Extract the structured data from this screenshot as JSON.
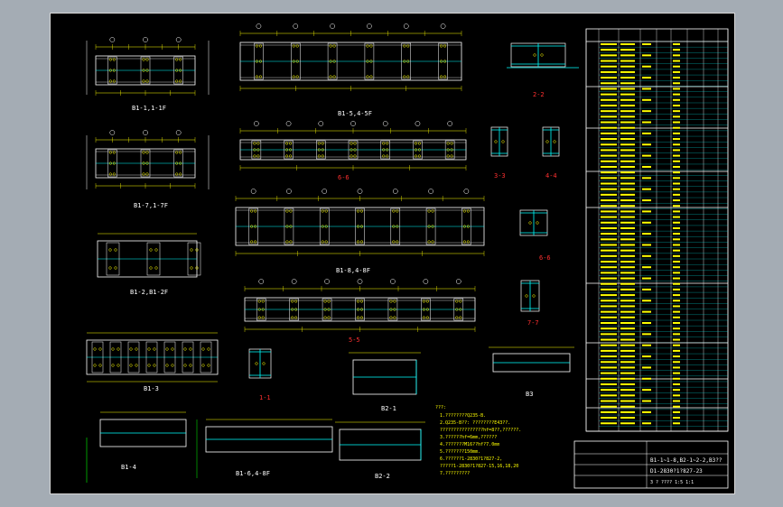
{
  "colors": {
    "background": "#a4acb4",
    "sheet": "#000000",
    "line": "#ffffff",
    "dimension": "#ffff00",
    "plate": "#00ffff",
    "bolt": "#ffff00",
    "grid": "#00ff00",
    "section_title": "#ff3030"
  },
  "views": {
    "b1_1": {
      "title": "B1-1,1-1F"
    },
    "b1_5": {
      "title": "B1-5,4-5F"
    },
    "b1_7": {
      "title": "B1-7,1-7F"
    },
    "b1_6": {
      "title": "6-6"
    },
    "b1_2": {
      "title": "B1-2,B1-2F"
    },
    "b1_8": {
      "title": "B1-8,4-8F"
    },
    "b1_3": {
      "title": "B1-3"
    },
    "b1_4": {
      "title": "B1-4"
    },
    "b1_6f": {
      "title": "B1-6,4-8F"
    },
    "b2_1": {
      "title": "B2-1"
    },
    "b2_2": {
      "title": "B2-2"
    },
    "b3": {
      "title": "B3"
    },
    "sec_2_2": {
      "title": "2-2"
    },
    "sec_3_3": {
      "title": "3-3"
    },
    "sec_4_4": {
      "title": "4-4"
    },
    "sec_6_6": {
      "title": "6-6"
    },
    "sec_7_7": {
      "title": "7-7"
    },
    "sec_1_1": {
      "title": "1-1"
    },
    "sec_5_5": {
      "title": "5-5"
    }
  },
  "notes": {
    "heading": "???:",
    "lines": [
      "1.????????Q235-B.",
      "2.Q235-B??: ????????E43??.",
      "  ????????????????hf=8??,??????.",
      "3.??????hf=6mm,??????",
      "4.???????M16??hf?7.0mm",
      "5.???????150mm.",
      "6.??????1-2830?1?827-2,",
      "  ?????1-2830?1?827-15,16,18,20",
      "7.?????????"
    ]
  },
  "title_block": {
    "line1": "B1-1~1-8,B2-1~2-2,B3??",
    "line2": "D1-2830?1?827-23",
    "line3": "3 ?  ???? 1:5  1:1"
  }
}
